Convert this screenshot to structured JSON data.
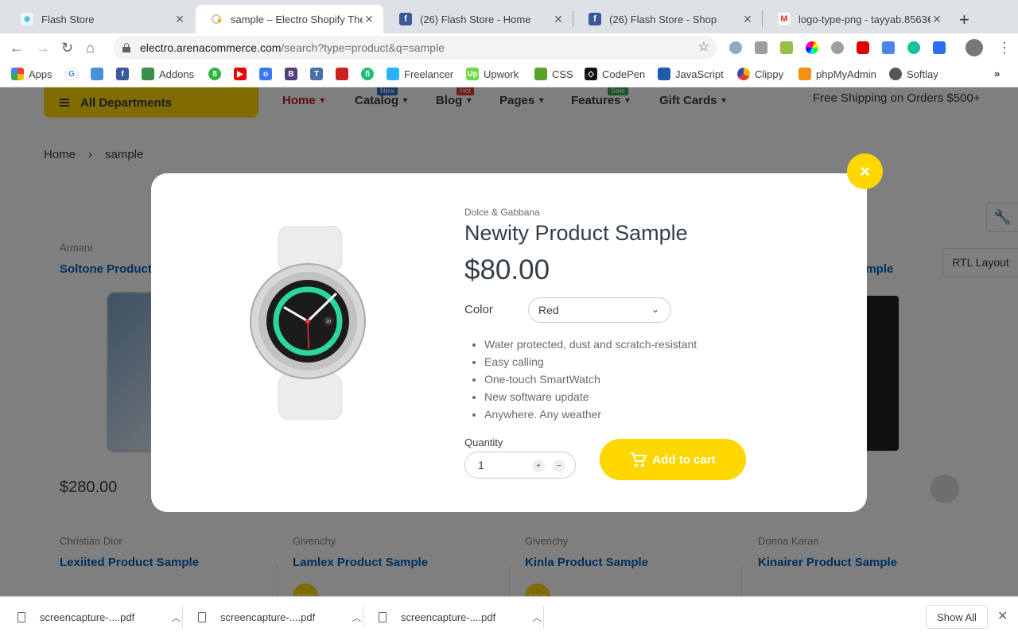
{
  "tabs": [
    {
      "title": "Flash Store",
      "icon": "react-icon",
      "color": "#61dafb"
    },
    {
      "title": "sample – Electro Shopify Theme",
      "icon": "loading-icon",
      "color": "#f4b400"
    },
    {
      "title": "(26) Flash Store - Home",
      "icon": "facebook-icon",
      "color": "#3b5998"
    },
    {
      "title": "(26) Flash Store - Shop",
      "icon": "facebook-icon",
      "color": "#3b5998"
    },
    {
      "title": "logo-type-png - tayyab.8563€",
      "icon": "gmail-icon",
      "color": "#d93025"
    }
  ],
  "url": {
    "host": "electro.arenacommerce.com",
    "path": "/search?type=product&q=sample"
  },
  "bookmarks": [
    "Apps",
    "Addons",
    "Freelancer",
    "Upwork",
    "CSS",
    "CodePen",
    "JavaScript",
    "Clippy",
    "phpMyAdmin",
    "Softlay"
  ],
  "header": {
    "all_departments": "All Departments",
    "nav": [
      {
        "label": "Home",
        "badge": ""
      },
      {
        "label": "Catalog",
        "badge": "New"
      },
      {
        "label": "Blog",
        "badge": "Hot"
      },
      {
        "label": "Pages",
        "badge": ""
      },
      {
        "label": "Features",
        "badge": "Sale"
      },
      {
        "label": "Gift Cards",
        "badge": ""
      }
    ],
    "free_shipping": "Free Shipping on Orders $500+"
  },
  "breadcrumb": {
    "home": "Home",
    "separator": "›",
    "current": "sample"
  },
  "background_products": {
    "row1": [
      {
        "brand": "Armani",
        "title": "Soltone Product",
        "price": "$280.00"
      },
      {
        "title_suffix": "ample"
      }
    ],
    "row2": [
      {
        "brand": "Christian Dior",
        "title": "Lexiited Product Sample"
      },
      {
        "brand": "Givenchy",
        "title": "Lamlex Product Sample"
      },
      {
        "brand": "Givenchy",
        "title": "Kinla Product Sample"
      },
      {
        "brand": "Donna Karan",
        "title": "Kinairer Product Sample"
      }
    ],
    "sale_badge": "SALE"
  },
  "side_tools": {
    "rtl_label": "RTL Layout"
  },
  "modal": {
    "close_label": "×",
    "brand": "Dolce & Gabbana",
    "title": "Newity Product Sample",
    "price": "$80.00",
    "color_label": "Color",
    "color_value": "Red",
    "features": [
      "Water protected, dust and scratch-resistant",
      "Easy calling",
      "One-touch SmartWatch",
      "New software update",
      "Anywhere. Any weather"
    ],
    "quantity_label": "Quantity",
    "quantity_value": "1",
    "add_to_cart": "Add to cart",
    "watch_dial_number": "20"
  },
  "downloads": [
    "screencapture-....pdf",
    "screencapture-....pdf",
    "screencapture-....pdf"
  ],
  "show_all": "Show All",
  "colors": {
    "accent_yellow": "#fed700",
    "link_blue": "#0062bd",
    "nav_red": "#c21a1a",
    "text_dark": "#333e48"
  }
}
